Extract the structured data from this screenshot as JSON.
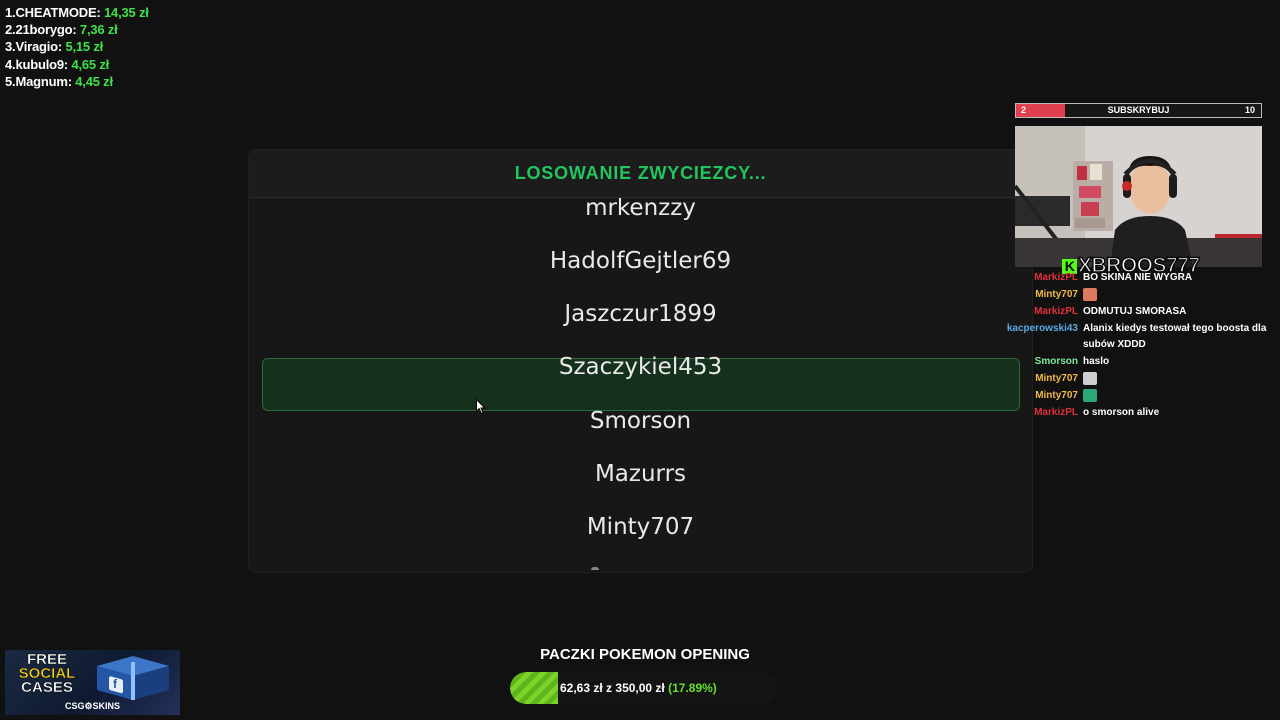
{
  "leaderboard": [
    {
      "rank": "1.",
      "name": "CHEATMODE:",
      "amount": "14,35 zł"
    },
    {
      "rank": "2.",
      "name": "21borygo:",
      "amount": "7,36 zł"
    },
    {
      "rank": "3.",
      "name": "Viragio:",
      "amount": "5,15 zł"
    },
    {
      "rank": "4.",
      "name": "kubulo9:",
      "amount": "4,65 zł"
    },
    {
      "rank": "5.",
      "name": "Magnum:",
      "amount": "4,45 zł"
    }
  ],
  "draw": {
    "title": "LOSOWANIE ZWYCIEZCY...",
    "names": [
      "mrkenzzy",
      "HadolfGejtler69",
      "Jaszczur1899",
      "Szaczykiel453",
      "Smorson",
      "Mazurrs",
      "Minty707"
    ],
    "highlighted_name": "Szaczykiel453",
    "accent": "#22c55e"
  },
  "subscribe": {
    "current": "2",
    "label": "SUBSKRYBUJ",
    "goal": "10",
    "progress": 0.2,
    "fill_color": "#e0404e"
  },
  "streamer": {
    "name": "XBROOS777",
    "platform_icon": "kick-icon"
  },
  "chat": [
    {
      "user": "MarkizPL",
      "color": "#e0303a",
      "text": "BO SKINA NIE WYGRA"
    },
    {
      "user": "Minty707",
      "color": "#f0b94a",
      "text": "",
      "emote": "face-emote"
    },
    {
      "user": "MarkizPL",
      "color": "#e0303a",
      "text": "ODMUTUJ SMORASA"
    },
    {
      "user": "kacperowski43",
      "color": "#5aa9e6",
      "text": "Alanix kiedys testował tego boosta dla subów XDDD"
    },
    {
      "user": "Smorson",
      "color": "#7ee8a0",
      "text": "haslo"
    },
    {
      "user": "Minty707",
      "color": "#f0b94a",
      "text": "",
      "emote": "skull-emote"
    },
    {
      "user": "Minty707",
      "color": "#f0b94a",
      "text": "",
      "emote": "car-emote"
    },
    {
      "user": "MarkizPL",
      "color": "#e0303a",
      "text": "o smorson alive"
    }
  ],
  "ad": {
    "line1": "FREE",
    "line2": "SOCIAL",
    "line3": "CASES",
    "brand": "CSG⚙SKINS"
  },
  "goal": {
    "title": "PACZKI POKEMON OPENING",
    "current": "62,63 zł",
    "separator": "z",
    "target": "350,00 zł",
    "percent": "(17.89%)",
    "progress": 0.1789
  }
}
